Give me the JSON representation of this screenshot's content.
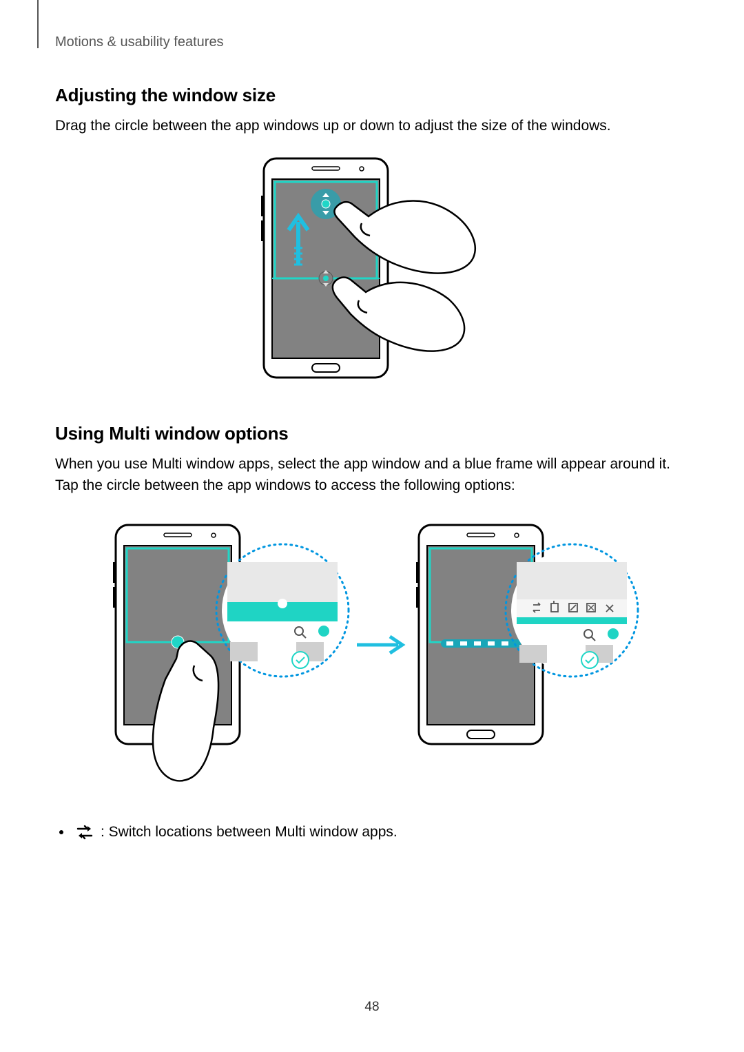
{
  "header": "Motions & usability features",
  "section1": {
    "heading": "Adjusting the window size",
    "body": "Drag the circle between the app windows up or down to adjust the size of the windows."
  },
  "section2": {
    "heading": "Using Multi window options",
    "body": "When you use Multi window apps, select the app window and a blue frame will appear around it. Tap the circle between the app windows to access the following options:"
  },
  "bullet1": {
    "icon": "swap-apps-icon",
    "text": ": Switch locations between Multi window apps."
  },
  "pageNumber": "48"
}
